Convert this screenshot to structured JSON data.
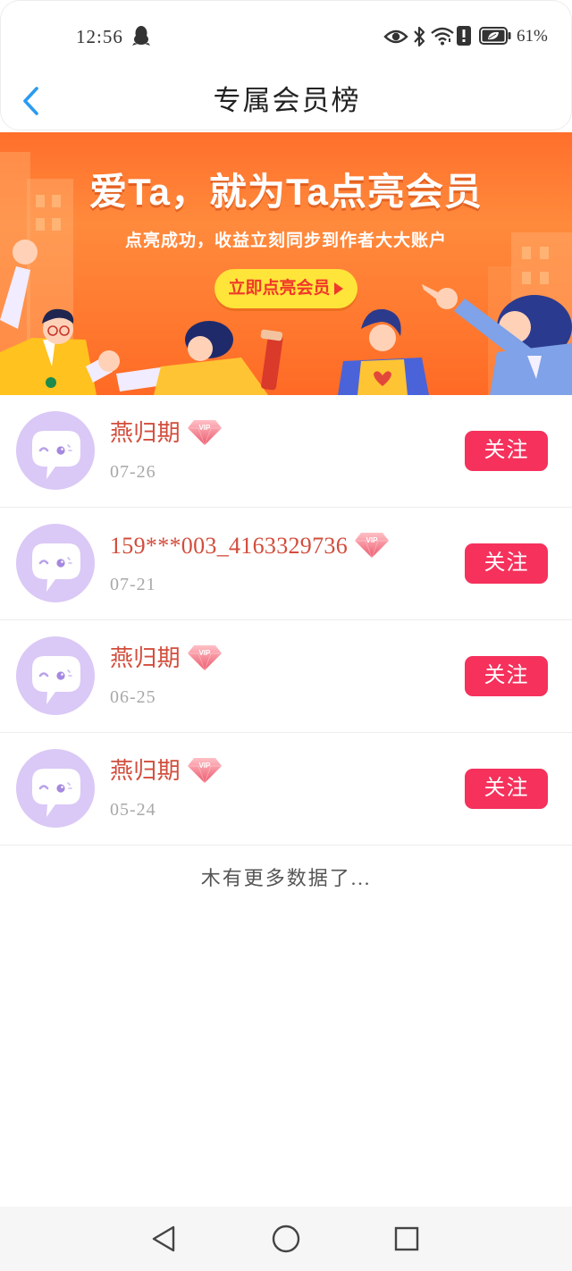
{
  "status_bar": {
    "time": "12:56",
    "battery_percent": "61%",
    "icons": [
      "qq-icon",
      "eye-icon",
      "bluetooth-icon",
      "wifi-icon",
      "alert-icon",
      "battery-icon"
    ]
  },
  "header": {
    "title": "专属会员榜",
    "back_icon": "chevron-left-icon"
  },
  "banner": {
    "headline": "爱Ta，就为Ta点亮会员",
    "subtitle": "点亮成功，收益立刻同步到作者大大账户",
    "cta_label": "立即点亮会员",
    "cta_icon": "play-triangle-icon"
  },
  "members": [
    {
      "name": "燕归期",
      "badge": "VIP",
      "date": "07-26",
      "follow_label": "关注"
    },
    {
      "name": "159***003_4163329736",
      "badge": "VIP",
      "date": "07-21",
      "follow_label": "关注"
    },
    {
      "name": "燕归期",
      "badge": "VIP",
      "date": "06-25",
      "follow_label": "关注"
    },
    {
      "name": "燕归期",
      "badge": "VIP",
      "date": "05-24",
      "follow_label": "关注"
    }
  ],
  "footer": {
    "end_text": "木有更多数据了..."
  },
  "nav_bar": {
    "icons": [
      "back-triangle-icon",
      "home-circle-icon",
      "recents-square-icon"
    ]
  },
  "colors": {
    "accent_blue": "#2b9bf0",
    "banner_orange": "#ff7a30",
    "cta_yellow": "#ffe43a",
    "name_red": "#d24d3c",
    "follow_pink": "#f5315c",
    "avatar_lavender": "#dac8f6"
  }
}
